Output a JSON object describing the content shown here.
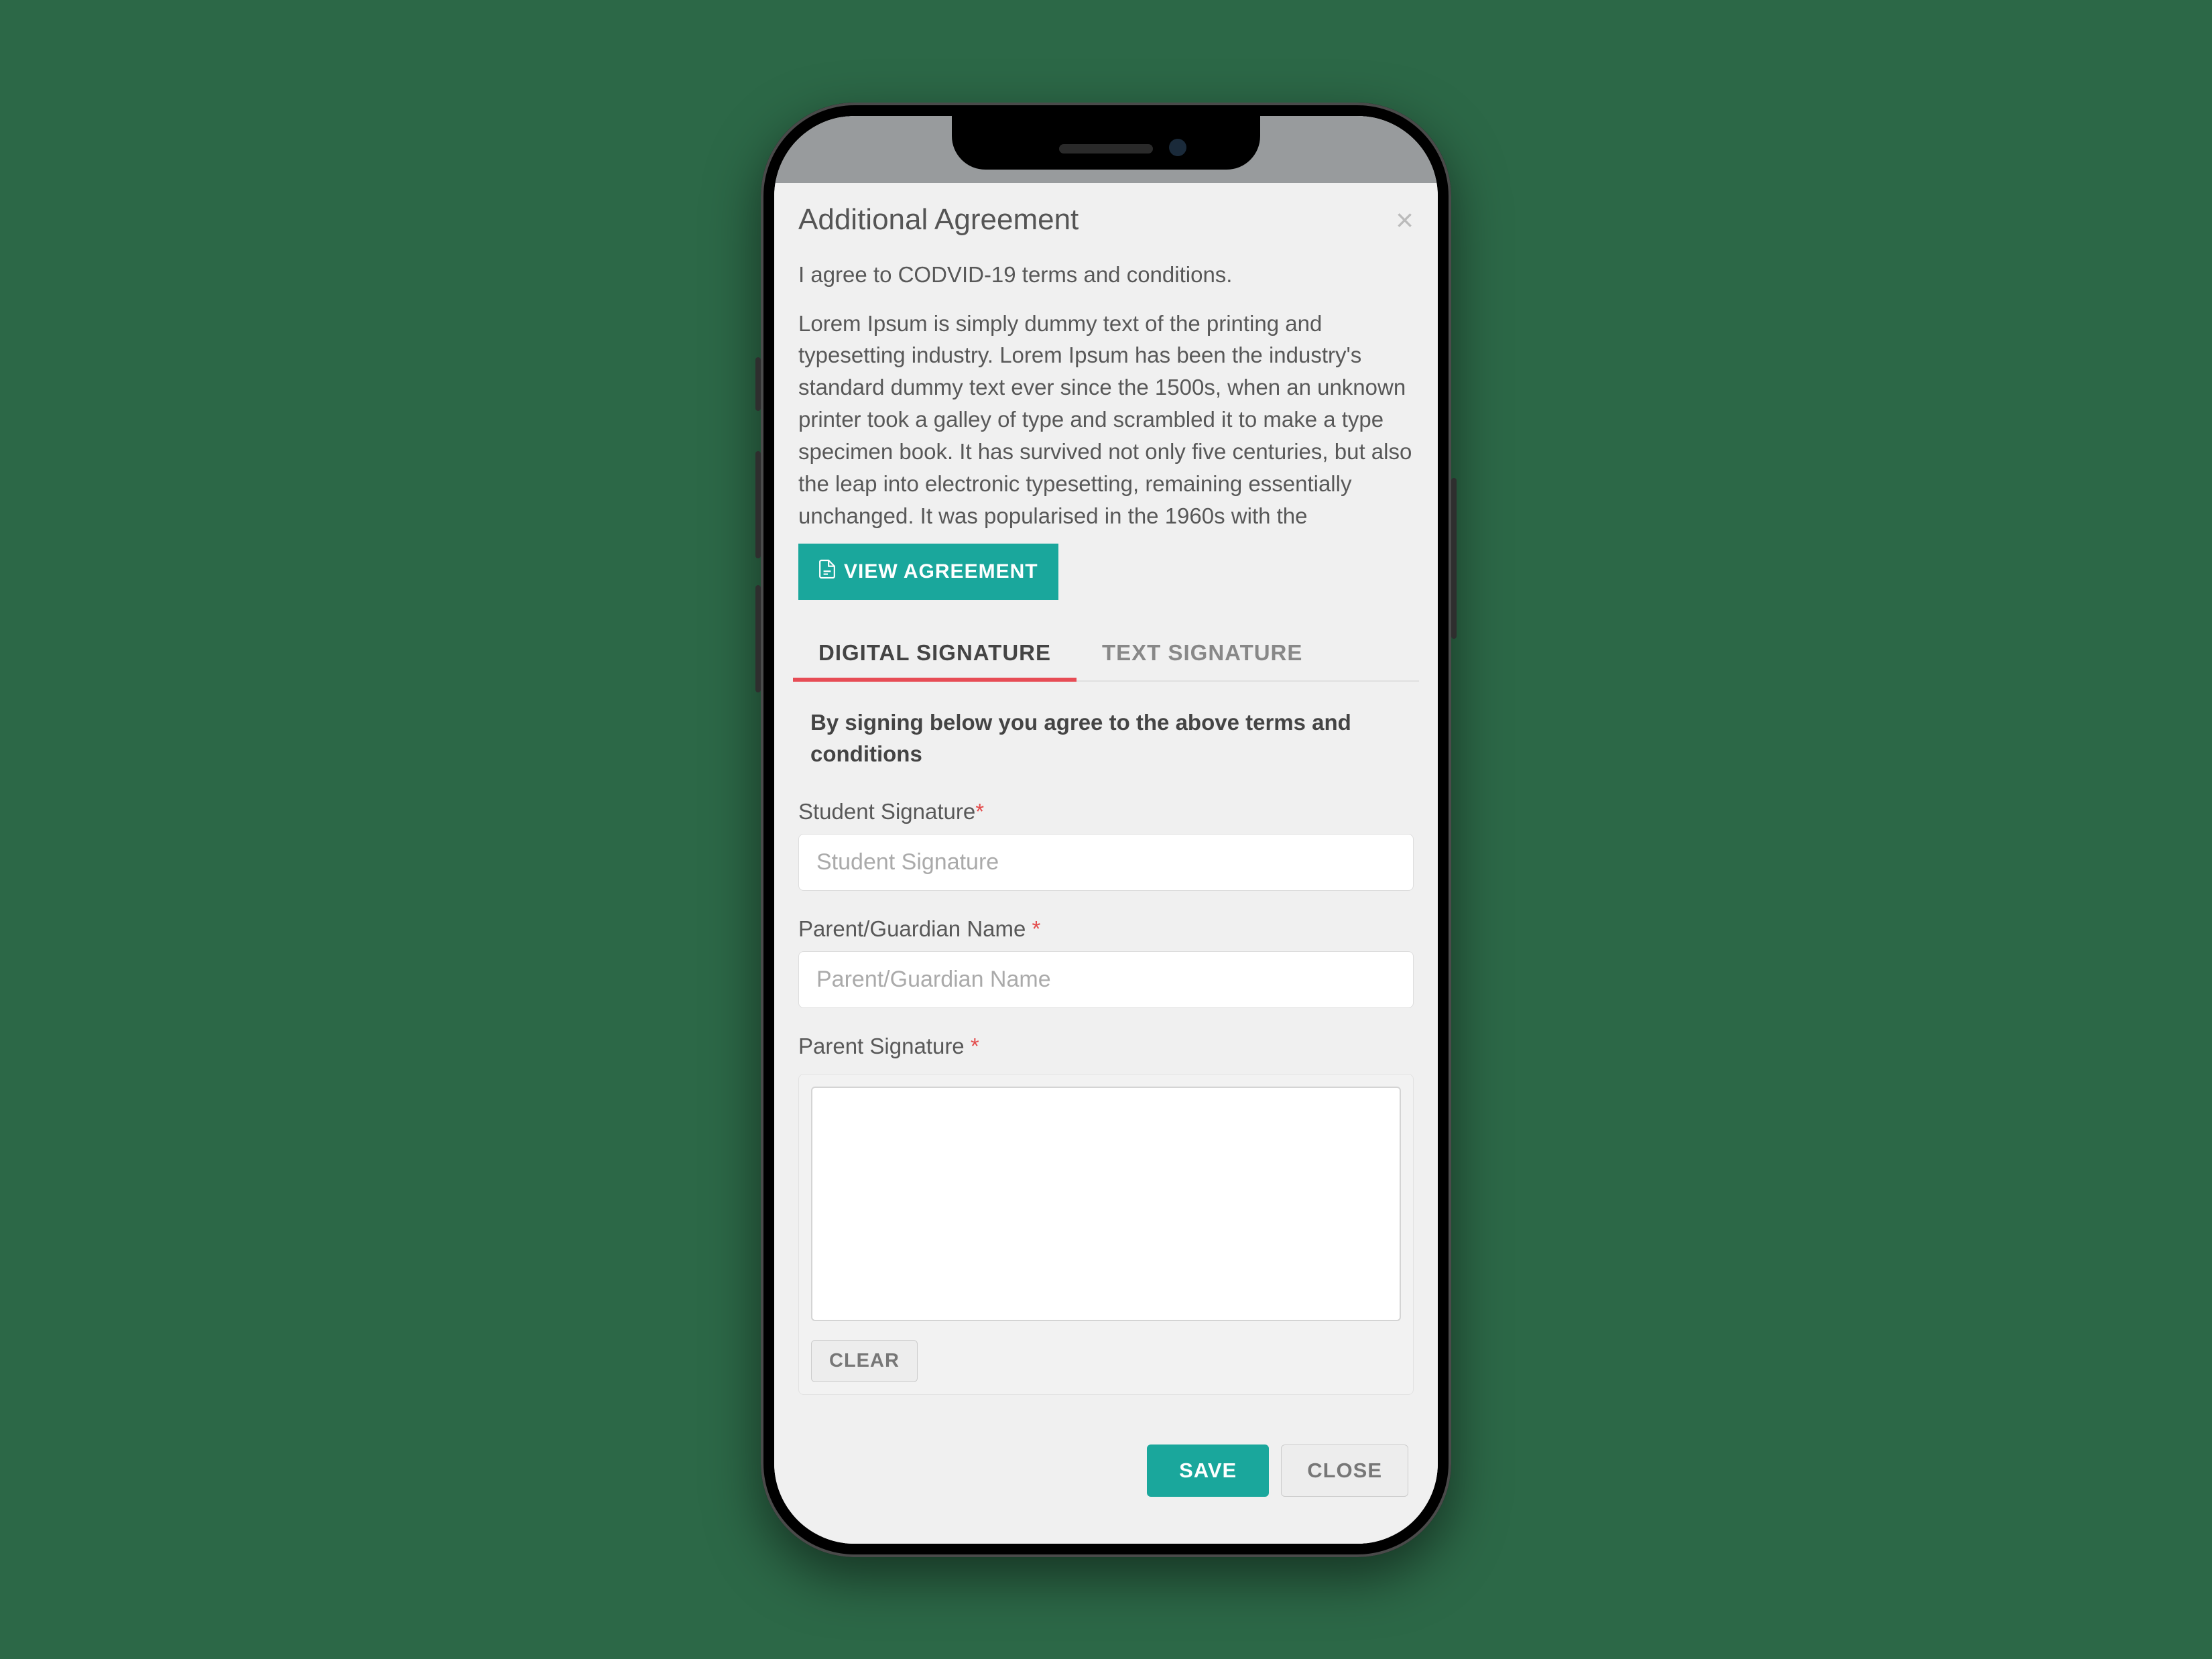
{
  "modal": {
    "title": "Additional Agreement",
    "close": "×"
  },
  "agreement": {
    "intro": "I agree to CODVID-19 terms and conditions.",
    "body": "Lorem Ipsum is simply dummy text of the printing and typesetting industry. Lorem Ipsum has been the industry's standard dummy text ever since the 1500s, when an unknown printer took a galley of type and scrambled it to make a type specimen book. It has survived not only five centuries, but also the leap into electronic typesetting, remaining essentially unchanged. It was popularised in the 1960s with the",
    "view_label": "VIEW AGREEMENT"
  },
  "tabs": {
    "digital": "DIGITAL SIGNATURE",
    "text": "TEXT SIGNATURE"
  },
  "form": {
    "consent": "By signing below you agree to the above terms and conditions",
    "student_sig_label": "Student Signature",
    "student_sig_placeholder": "Student Signature",
    "parent_name_label": "Parent/Guardian Name ",
    "parent_name_placeholder": "Parent/Guardian Name",
    "parent_sig_label": "Parent Signature ",
    "clear": "CLEAR",
    "save": "SAVE",
    "close": "CLOSE"
  },
  "colors": {
    "accent": "#1aa79c",
    "tab_active": "#e74c55",
    "required": "#e34a4a",
    "page_bg": "#2c6847"
  }
}
